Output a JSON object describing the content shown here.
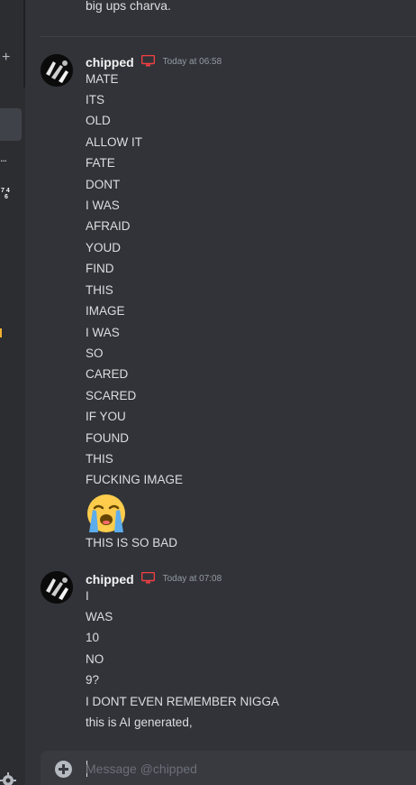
{
  "sidebar": {
    "plus_glyph": "+",
    "dots_glyph": "...",
    "badge_a": "7 4",
    "badge_b": "6"
  },
  "previous_message": {
    "text": "big ups charva."
  },
  "messages": [
    {
      "username": "chipped",
      "timestamp": "Today at 06:58",
      "lines": [
        "MATE",
        "ITS",
        "OLD",
        "ALLOW IT",
        "FATE",
        "DONT",
        "I WAS",
        "AFRAID",
        "YOUD",
        "FIND",
        "THIS",
        "IMAGE",
        "I WAS",
        "SO",
        "CARED",
        "SCARED",
        "IF YOU",
        "FOUND",
        "THIS",
        "FUCKING IMAGE"
      ],
      "emoji": "loudly-crying-face",
      "after_emoji": "THIS IS SO BAD"
    },
    {
      "username": "chipped",
      "timestamp": "Today at 07:08",
      "lines": [
        "I",
        "WAS",
        "10",
        "NO",
        "9?",
        "I DONT EVEN REMEMBER NIGGA",
        "this is AI generated,"
      ]
    }
  ],
  "composer": {
    "placeholder": "Message @chipped",
    "value": ""
  },
  "colors": {
    "background": "#313338",
    "sidebar": "#2b2d31",
    "text": "#dbdee1",
    "username": "#f2f3f5",
    "timestamp": "#949ba4",
    "device_icon": "#f23f43",
    "input": "#383a40"
  }
}
